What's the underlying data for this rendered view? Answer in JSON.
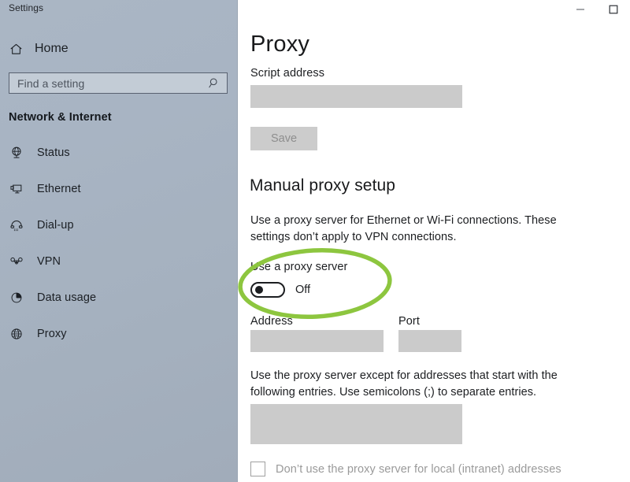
{
  "window": {
    "title": "Settings",
    "controls": [
      {
        "name": "minimize",
        "glyph": "minimize-icon"
      },
      {
        "name": "maximize",
        "glyph": "maximize-icon"
      }
    ]
  },
  "sidebar": {
    "home": {
      "label": "Home",
      "icon": "home-icon"
    },
    "search": {
      "value": "",
      "placeholder": "Find a setting",
      "icon": "search-icon"
    },
    "section_header": "Network & Internet",
    "items": [
      {
        "label": "Status",
        "icon": "globe-stand-icon",
        "selected": false
      },
      {
        "label": "Ethernet",
        "icon": "monitor-icon",
        "selected": false
      },
      {
        "label": "Dial-up",
        "icon": "telephone-icon",
        "selected": false
      },
      {
        "label": "VPN",
        "icon": "vpn-icon",
        "selected": false
      },
      {
        "label": "Data usage",
        "icon": "pie-chart-icon",
        "selected": false
      },
      {
        "label": "Proxy",
        "icon": "globe-icon",
        "selected": true
      }
    ]
  },
  "main": {
    "title": "Proxy",
    "script_address": {
      "label": "Script address",
      "value": "",
      "placeholder": ""
    },
    "save_button": {
      "label": "Save",
      "disabled": true
    },
    "manual_setup": {
      "heading": "Manual proxy setup",
      "description": "Use a proxy server for Ethernet or Wi-Fi connections. These settings don’t apply to VPN connections.",
      "toggle": {
        "label": "Use a proxy server",
        "state": "Off",
        "checked": false
      },
      "address": {
        "label": "Address",
        "value": "",
        "placeholder": ""
      },
      "port": {
        "label": "Port",
        "value": "",
        "placeholder": ""
      },
      "exceptions": {
        "description": "Use the proxy server except for addresses that start with the following entries. Use semicolons (;) to separate entries.",
        "value": "",
        "placeholder": ""
      },
      "bypass_local": {
        "label": "Don’t use the proxy server for local (intranet) addresses",
        "checked": false,
        "disabled": true
      }
    }
  },
  "annotation": {
    "type": "ellipse-highlight",
    "color": "#8dc63f",
    "target": "use-a-proxy-server-toggle"
  },
  "colors": {
    "sidebar_top": "#aab6c4",
    "sidebar_bottom": "#a1acba",
    "field_gray": "#cbcbcb",
    "button_gray": "#cccccc",
    "text": "#1c1e21",
    "disabled_text": "#9a9a9a",
    "annotation_green": "#8dc63f"
  }
}
